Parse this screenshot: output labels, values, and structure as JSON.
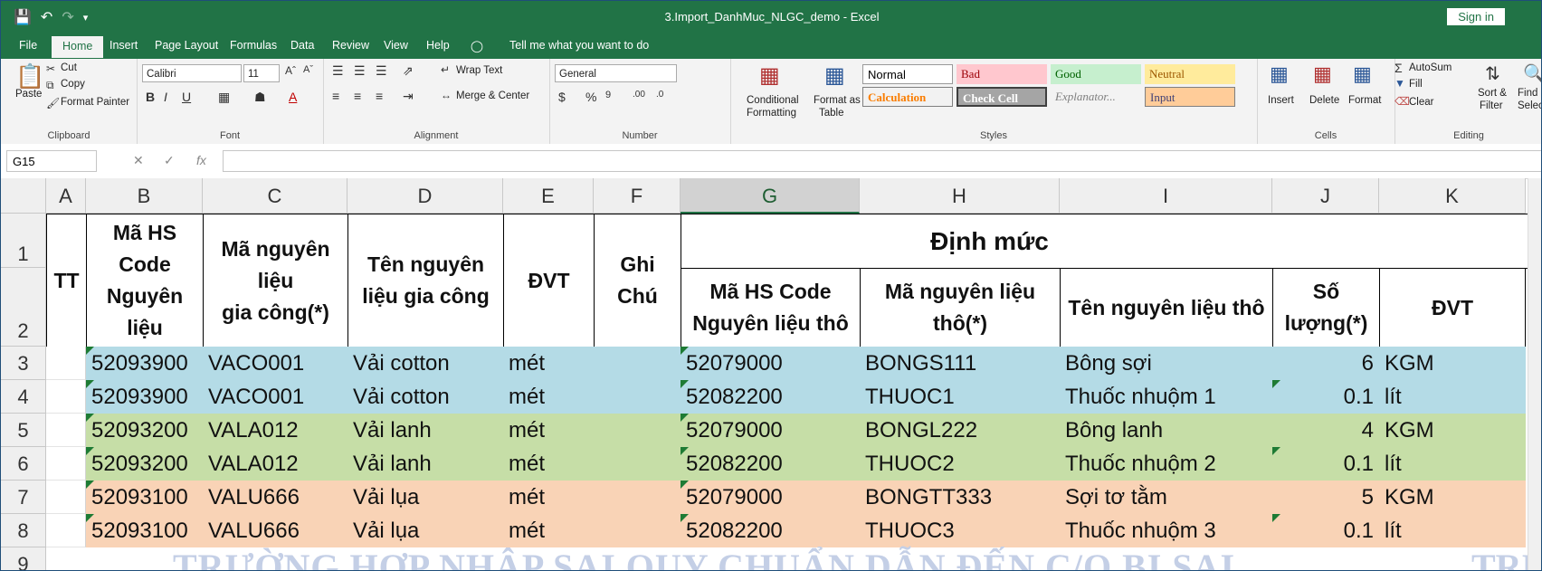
{
  "titlebar": {
    "title": "3.Import_DanhMuc_NLGC_demo  -  Excel",
    "signin": "Sign in"
  },
  "tabs": [
    "File",
    "Home",
    "Insert",
    "Page Layout",
    "Formulas",
    "Data",
    "Review",
    "View",
    "Help"
  ],
  "tell_me": "Tell me what you want to do",
  "ribbon": {
    "clipboard": {
      "paste": "Paste",
      "cut": "Cut",
      "copy": "Copy",
      "format_painter": "Format Painter",
      "label": "Clipboard"
    },
    "font": {
      "name": "Calibri",
      "size": "11",
      "label": "Font"
    },
    "alignment": {
      "wrap": "Wrap Text",
      "merge": "Merge & Center",
      "label": "Alignment"
    },
    "number": {
      "format": "General",
      "label": "Number"
    },
    "styles": {
      "conditional": "Conditional",
      "conditional2": "Formatting",
      "format_as": "Format as",
      "format_as2": "Table",
      "normal": "Normal",
      "bad": "Bad",
      "good": "Good",
      "neutral": "Neutral",
      "calculation": "Calculation",
      "check_cell": "Check Cell",
      "explanatory": "Explanator...",
      "input": "Input",
      "label": "Styles"
    },
    "cells": {
      "insert": "Insert",
      "delete": "Delete",
      "format": "Format",
      "label": "Cells"
    },
    "editing": {
      "autosum": "AutoSum",
      "fill": "Fill",
      "clear": "Clear",
      "sort": "Sort &",
      "sort2": "Filter",
      "find": "Find &",
      "find2": "Select",
      "label": "Editing"
    }
  },
  "formula_bar": {
    "name_box": "G15",
    "fx": "fx",
    "content": ""
  },
  "columns": [
    "A",
    "B",
    "C",
    "D",
    "E",
    "F",
    "G",
    "H",
    "I",
    "J",
    "K"
  ],
  "selected_column": "G",
  "rows": [
    "1",
    "2",
    "3",
    "4",
    "5",
    "6",
    "7",
    "8",
    "9"
  ],
  "headers": {
    "tt": "TT",
    "b": [
      "Mã HS",
      "Code",
      "Nguyên",
      "liệu"
    ],
    "c": [
      "Mã nguyên",
      "liệu",
      "gia công(*)"
    ],
    "d": [
      "Tên nguyên",
      "liệu gia công"
    ],
    "e": "ĐVT",
    "f": [
      "Ghi",
      "Chú"
    ],
    "dinh_muc": "Định mức",
    "g": [
      "Mã HS Code",
      "Nguyên liệu thô"
    ],
    "h": [
      "Mã nguyên liệu",
      "thô(*)"
    ],
    "i": "Tên nguyên liệu thô",
    "j": [
      "Số",
      "lượng(*)"
    ],
    "k": "ĐVT"
  },
  "data_rows": [
    {
      "hs": "52093900",
      "ma": "VACO001",
      "ten": "Vải cotton",
      "dvt": "mét",
      "hs_tho": "52079000",
      "ma_tho": "BONGS111",
      "ten_tho": "Bông sợi",
      "sl": "6",
      "dvt_tho": "KGM",
      "color": "#b4dbe6"
    },
    {
      "hs": "52093900",
      "ma": "VACO001",
      "ten": "Vải cotton",
      "dvt": "mét",
      "hs_tho": "52082200",
      "ma_tho": "THUOC1",
      "ten_tho": "Thuốc nhuộm 1",
      "sl": "0.1",
      "dvt_tho": "lít",
      "color": "#b4dbe6"
    },
    {
      "hs": "52093200",
      "ma": "VALA012",
      "ten": "Vải lanh",
      "dvt": "mét",
      "hs_tho": "52079000",
      "ma_tho": "BONGL222",
      "ten_tho": "Bông lanh",
      "sl": "4",
      "dvt_tho": "KGM",
      "color": "#c6dea7"
    },
    {
      "hs": "52093200",
      "ma": "VALA012",
      "ten": "Vải lanh",
      "dvt": "mét",
      "hs_tho": "52082200",
      "ma_tho": "THUOC2",
      "ten_tho": "Thuốc nhuộm 2",
      "sl": "0.1",
      "dvt_tho": "lít",
      "color": "#c6dea7"
    },
    {
      "hs": "52093100",
      "ma": "VALU666",
      "ten": "Vải lụa",
      "dvt": "mét",
      "hs_tho": "52079000",
      "ma_tho": "BONGTT333",
      "ten_tho": "Sợi tơ tằm",
      "sl": "5",
      "dvt_tho": "KGM",
      "color": "#f9d3b6"
    },
    {
      "hs": "52093100",
      "ma": "VALU666",
      "ten": "Vải lụa",
      "dvt": "mét",
      "hs_tho": "52082200",
      "ma_tho": "THUOC3",
      "ten_tho": "Thuốc nhuộm 3",
      "sl": "0.1",
      "dvt_tho": "lít",
      "color": "#f9d3b6"
    }
  ],
  "watermark": "TRƯỜNG HỢP NHẬP SAI QUY CHUẨN DẪN ĐẾN C/O BỊ SAI",
  "watermark2": "TRƯỜ"
}
